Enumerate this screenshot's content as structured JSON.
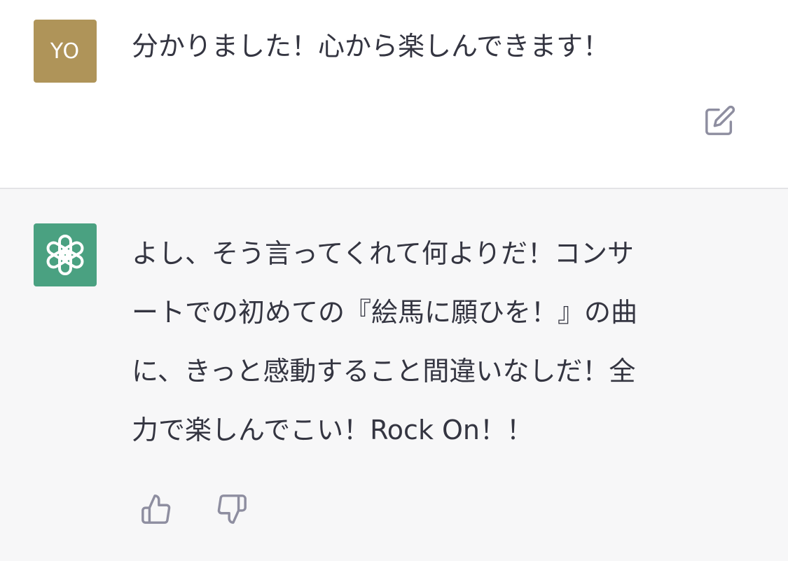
{
  "user_message": {
    "avatar_initials": "YO",
    "text": "分かりました！心から楽しんできます！"
  },
  "assistant_message": {
    "lines": [
      "よし、そう言ってくれて何よりだ！コンサ",
      "ートでの初めての『絵馬に願ひを！』の曲",
      "に、きっと感動すること間違いなしだ！全",
      "力で楽しんでこい！Rock On！！"
    ]
  },
  "icons": {
    "user_avatar": "user-initials-avatar",
    "assistant_avatar": "openai-logo-icon",
    "edit": "edit-icon",
    "thumb_up": "thumbs-up-icon",
    "thumb_down": "thumbs-down-icon"
  },
  "colors": {
    "user_avatar_bg": "#af9459",
    "assistant_avatar_bg": "#4aa181",
    "assistant_block_bg": "#f7f7f8",
    "text": "#343541",
    "icon": "#8e8ea0"
  }
}
